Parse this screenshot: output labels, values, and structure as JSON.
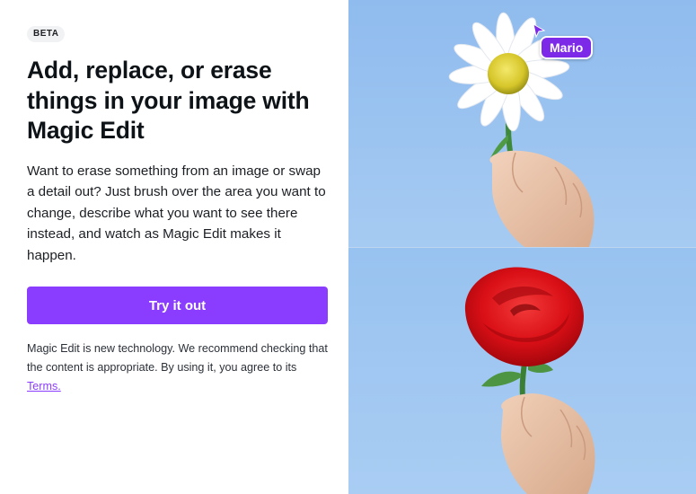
{
  "badge": {
    "text": "BETA"
  },
  "heading": {
    "text": "Add, replace, or erase things in your image with Magic Edit"
  },
  "description": {
    "text": "Want to erase something from an image or swap a detail out? Just brush over the area you want to change, describe what you want to see there instead, and watch as Magic Edit makes it happen."
  },
  "cta": {
    "label": "Try it out",
    "color": "#8b3dff"
  },
  "disclaimer": {
    "text": "Magic Edit is new technology. We recommend checking that the content is appropriate. By using it, you agree to its ",
    "link_label": "Terms."
  },
  "preview": {
    "cursor_name": "Mario",
    "cursor_color": "#7d2ae8",
    "top_image": "daisy-in-hand",
    "bottom_image": "red-rose-in-hand",
    "sky_color": "#9cc3ef"
  }
}
